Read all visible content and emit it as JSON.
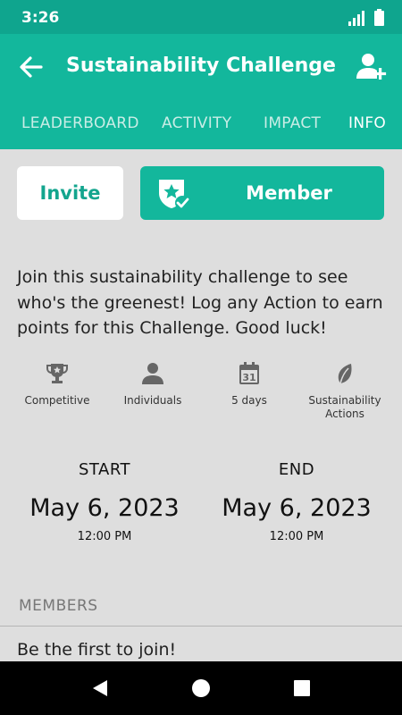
{
  "status_bar": {
    "time": "3:26"
  },
  "app_bar": {
    "title": "Sustainability Challenge"
  },
  "tabs": [
    {
      "label": "LEADERBOARD",
      "active": false
    },
    {
      "label": "ACTIVITY",
      "active": false
    },
    {
      "label": "IMPACT",
      "active": false
    },
    {
      "label": "INFO",
      "active": true
    }
  ],
  "actions": {
    "invite_label": "Invite",
    "member_label": "Member"
  },
  "description": "Join this sustainability challenge to see who's the greenest! Log any Action to earn points for this Challenge. Good luck!",
  "features": [
    {
      "icon": "trophy-icon",
      "label": "Competitive"
    },
    {
      "icon": "person-icon",
      "label": "Individuals"
    },
    {
      "icon": "calendar-icon",
      "label": "5 days",
      "calendar_number": "31"
    },
    {
      "icon": "leaf-icon",
      "label": "Sustainability Actions"
    }
  ],
  "schedule": {
    "start": {
      "label": "START",
      "date": "May 6, 2023",
      "time": "12:00 PM"
    },
    "end": {
      "label": "END",
      "date": "May 6, 2023",
      "time": "12:00 PM"
    }
  },
  "members": {
    "header": "MEMBERS",
    "empty_text": "Be the first to join!"
  },
  "colors": {
    "primary": "#13b79c",
    "status_bar": "#0fa58e",
    "background": "#dedede"
  }
}
